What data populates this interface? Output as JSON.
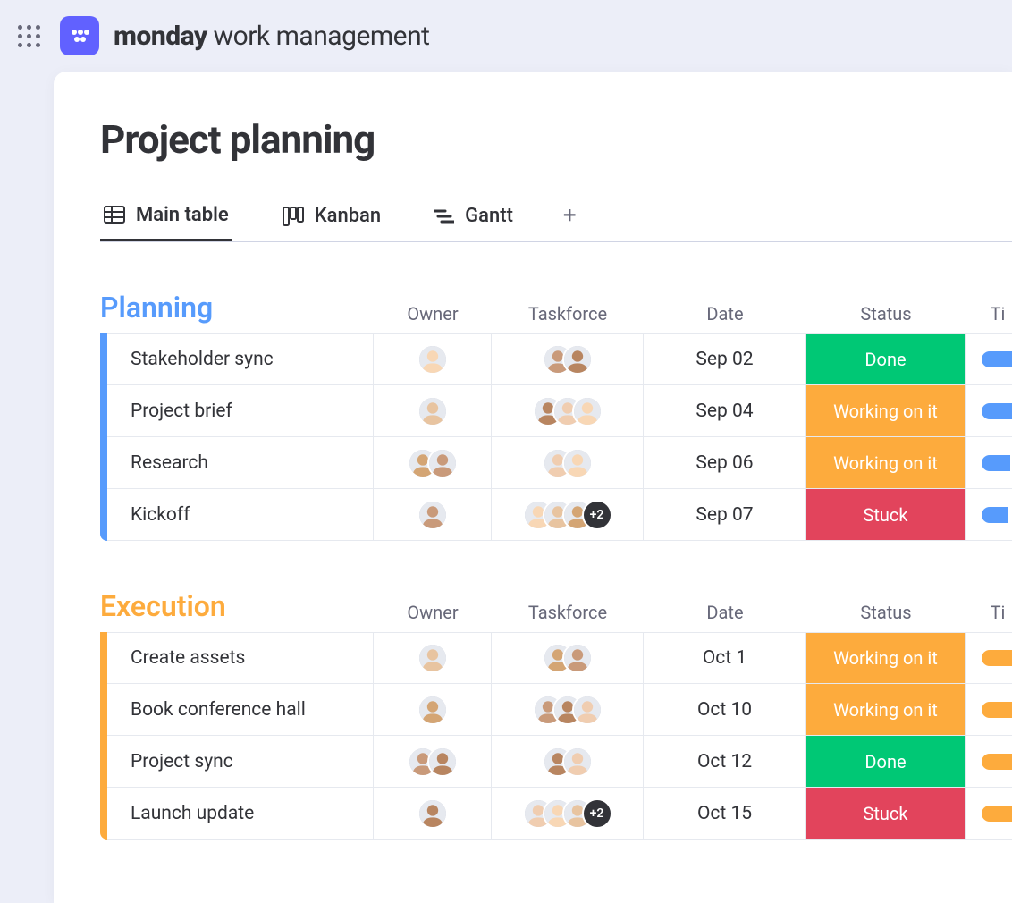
{
  "header": {
    "brand_bold": "monday",
    "brand_rest": " work management"
  },
  "page": {
    "title": "Project planning"
  },
  "tabs": [
    {
      "label": "Main table",
      "icon": "table",
      "active": true
    },
    {
      "label": "Kanban",
      "icon": "kanban",
      "active": false
    },
    {
      "label": "Gantt",
      "icon": "gantt",
      "active": false
    }
  ],
  "columns": {
    "owner": "Owner",
    "taskforce": "Taskforce",
    "date": "Date",
    "status": "Status",
    "timeline_partial": "Ti"
  },
  "status_colors": {
    "Done": "#00c875",
    "Working on it": "#fdab3d",
    "Stuck": "#e2445c"
  },
  "groups": [
    {
      "name": "Planning",
      "color": "#579bfc",
      "timeline_color": "#579bfc",
      "rows": [
        {
          "item": "Stakeholder sync",
          "owner_count": 1,
          "taskforce_count": 2,
          "taskforce_more": 0,
          "date": "Sep 02",
          "status": "Done",
          "tl_width": 44
        },
        {
          "item": "Project brief",
          "owner_count": 1,
          "taskforce_count": 3,
          "taskforce_more": 0,
          "date": "Sep 04",
          "status": "Working on it",
          "tl_width": 40
        },
        {
          "item": "Research",
          "owner_count": 2,
          "taskforce_count": 2,
          "taskforce_more": 0,
          "date": "Sep 06",
          "status": "Working on it",
          "tl_width": 32
        },
        {
          "item": "Kickoff",
          "owner_count": 1,
          "taskforce_count": 3,
          "taskforce_more": 2,
          "date": "Sep 07",
          "status": "Stuck",
          "tl_width": 30
        }
      ]
    },
    {
      "name": "Execution",
      "color": "#fdab3d",
      "timeline_color": "#fdab3d",
      "rows": [
        {
          "item": "Create assets",
          "owner_count": 1,
          "taskforce_count": 2,
          "taskforce_more": 0,
          "date": "Oct 1",
          "status": "Working on it",
          "tl_width": 34
        },
        {
          "item": "Book conference hall",
          "owner_count": 1,
          "taskforce_count": 3,
          "taskforce_more": 0,
          "date": "Oct 10",
          "status": "Working on it",
          "tl_width": 42
        },
        {
          "item": "Project sync",
          "owner_count": 2,
          "taskforce_count": 2,
          "taskforce_more": 0,
          "date": "Oct 12",
          "status": "Done",
          "tl_width": 42
        },
        {
          "item": "Launch update",
          "owner_count": 1,
          "taskforce_count": 3,
          "taskforce_more": 2,
          "date": "Oct 15",
          "status": "Stuck",
          "tl_width": 42
        }
      ]
    }
  ]
}
